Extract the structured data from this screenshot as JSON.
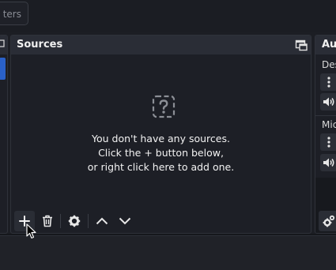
{
  "toolbar_top": {
    "filters_label": "ters"
  },
  "sources": {
    "title": "Sources",
    "empty_lines": [
      "You don't have any sources.",
      "Click the + button below,",
      "or right click here to add one."
    ],
    "toolbar": [
      "add",
      "remove",
      "properties",
      "move-up",
      "move-down"
    ]
  },
  "audio": {
    "title": "Au",
    "channels": [
      {
        "name": "Des"
      },
      {
        "name": "Mic"
      }
    ]
  },
  "colors": {
    "accent": "#2a61c9",
    "panel": "#1d1f26",
    "titlebar": "#2a2d36",
    "background": "#15171c"
  }
}
